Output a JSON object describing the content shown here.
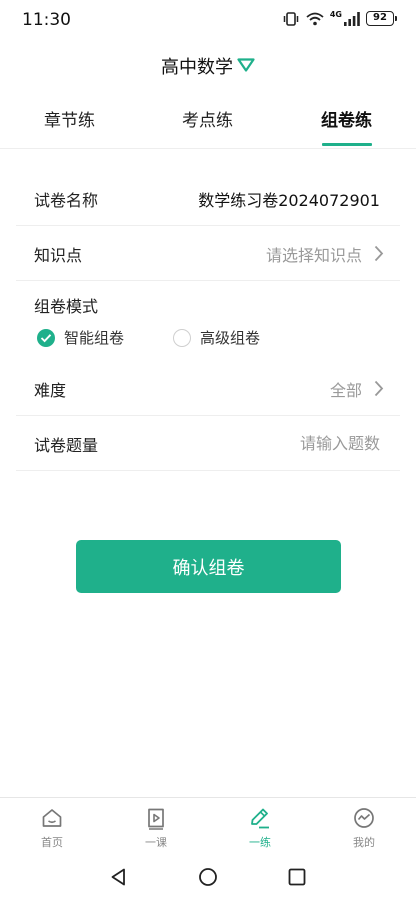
{
  "status_bar": {
    "time": "11:30",
    "network": "4G",
    "battery": "92"
  },
  "header": {
    "title": "高中数学"
  },
  "tabs": [
    {
      "label": "章节练",
      "active": false
    },
    {
      "label": "考点练",
      "active": false
    },
    {
      "label": "组卷练",
      "active": true
    }
  ],
  "form": {
    "paper_name": {
      "label": "试卷名称",
      "value": "数学练习卷2024072901"
    },
    "knowledge": {
      "label": "知识点",
      "placeholder": "请选择知识点"
    },
    "mode": {
      "label": "组卷模式",
      "options": [
        {
          "label": "智能组卷",
          "checked": true
        },
        {
          "label": "高级组卷",
          "checked": false
        }
      ]
    },
    "difficulty": {
      "label": "难度",
      "value": "全部"
    },
    "question_count": {
      "label": "试卷题量",
      "placeholder": "请输入题数",
      "value": ""
    }
  },
  "confirm_button": {
    "label": "确认组卷"
  },
  "bottom_nav": [
    {
      "label": "首页",
      "icon": "home-icon",
      "active": false
    },
    {
      "label": "一课",
      "icon": "video-lesson-icon",
      "active": false
    },
    {
      "label": "一练",
      "icon": "pencil-practice-icon",
      "active": true
    },
    {
      "label": "我的",
      "icon": "profile-icon",
      "active": false
    }
  ],
  "colors": {
    "accent": "#1fb08b",
    "muted_text": "#9a9a9a",
    "divider": "#eeeeee"
  }
}
